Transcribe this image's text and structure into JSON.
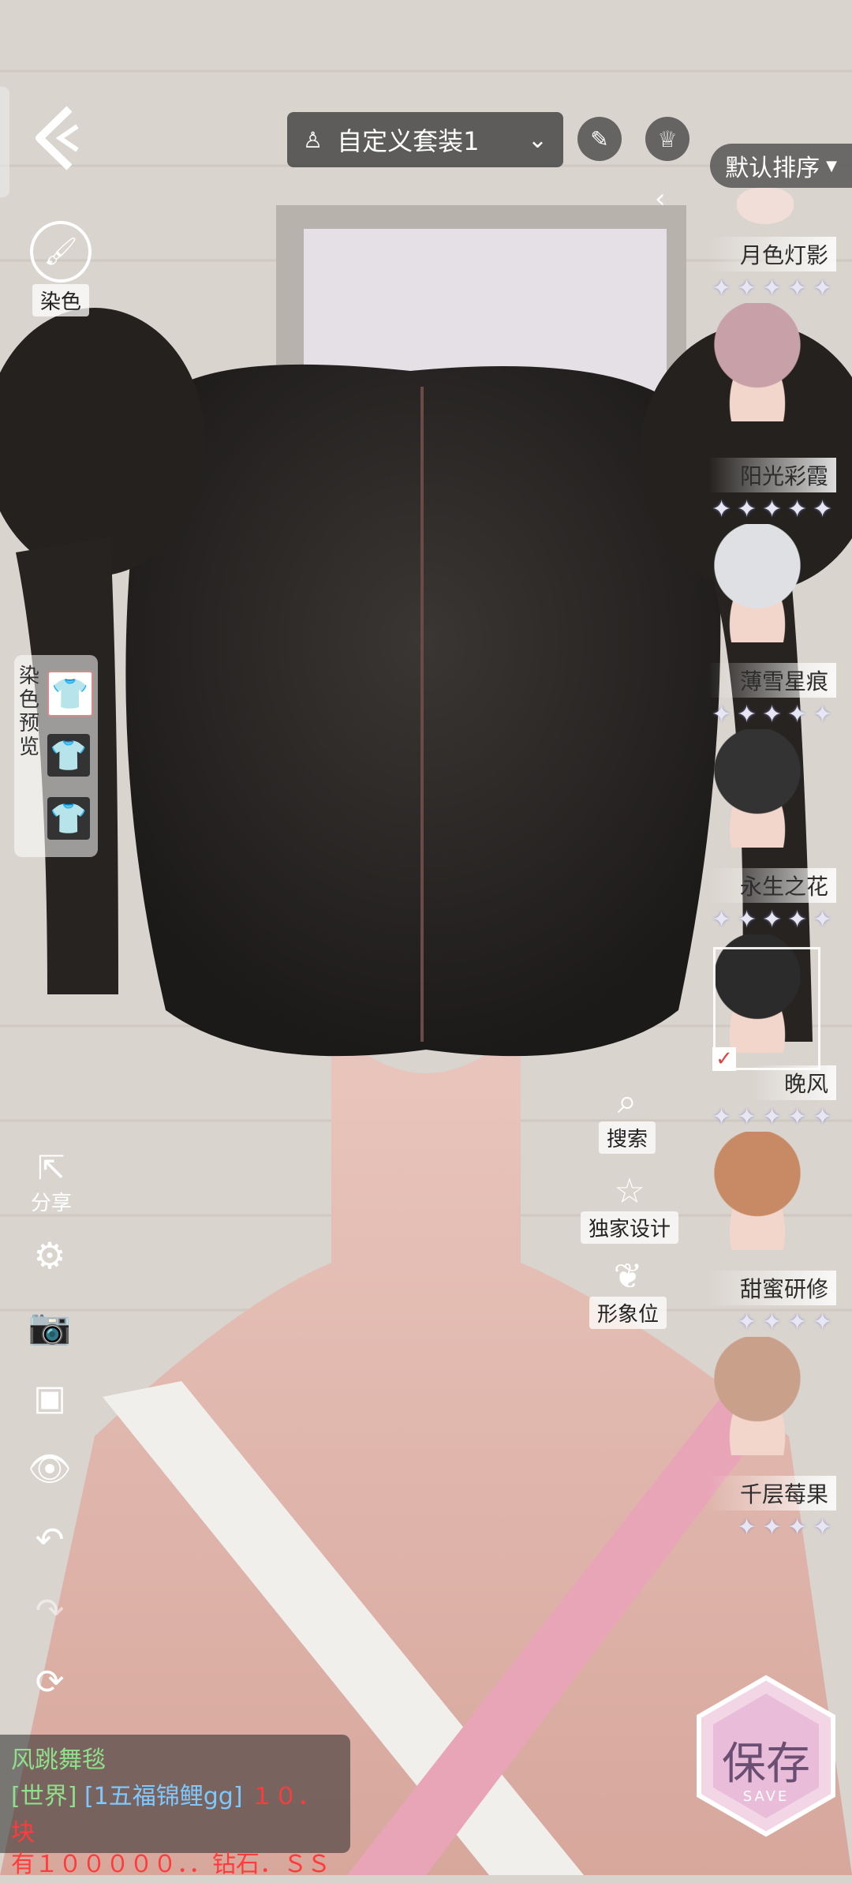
{
  "topbar": {
    "outfit_name": "自定义套装1",
    "sort_label": "默认排序"
  },
  "left": {
    "dye_label": "染色",
    "dye_preview_label": "染色预览",
    "share_label": "分享"
  },
  "right_actions": {
    "search_label": "搜索",
    "exclusive_label": "独家设计",
    "image_slot_label": "形象位"
  },
  "hair_list": [
    {
      "name": "月色灯影",
      "stars": 5
    },
    {
      "name": "阳光彩霞",
      "stars": 5
    },
    {
      "name": "薄雪星痕",
      "stars": 5
    },
    {
      "name": "永生之花",
      "stars": 5
    },
    {
      "name": "晚风",
      "stars": 5,
      "selected": true
    },
    {
      "name": "甜蜜研修",
      "stars": 4
    },
    {
      "name": "千层莓果",
      "stars": 4
    }
  ],
  "save": {
    "label": "保存",
    "sub_label": "SAVE"
  },
  "chat": {
    "line1": "风跳舞毯",
    "channel": "[世界]",
    "user": "[1五福锦鲤gg]",
    "msg_part1": "１０．块",
    "msg_part2": "有１０００００．．钻石．ＳＳ"
  },
  "colors": {
    "chat_green": "#8fe08a",
    "chat_blue": "#7fc8ff",
    "chat_red": "#ff3b3b",
    "save_pink": "#e6b7d6"
  }
}
